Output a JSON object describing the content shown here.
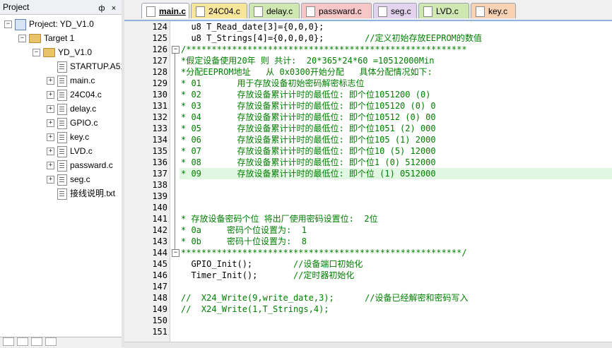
{
  "project_panel": {
    "title": "Project",
    "pin_label": "ф",
    "close_label": "×",
    "root": "Project: YD_V1.0",
    "target": "Target 1",
    "group": "YD_V1.0",
    "files": [
      "STARTUP.A51",
      "main.c",
      "24C04.c",
      "delay.c",
      "GPIO.c",
      "key.c",
      "LVD.c",
      "passward.c",
      "seg.c",
      "接线说明.txt"
    ]
  },
  "tabs": [
    {
      "label": "main.c",
      "color": "#ffffff",
      "active": true
    },
    {
      "label": "24C04.c",
      "color": "#f7e59a"
    },
    {
      "label": "delay.c",
      "color": "#cfe8b2"
    },
    {
      "label": "passward.c",
      "color": "#f7c6c6"
    },
    {
      "label": "seg.c",
      "color": "#e3d3ee"
    },
    {
      "label": "LVD.c",
      "color": "#cfe8b2"
    },
    {
      "label": "key.c",
      "color": "#f8d2b2"
    }
  ],
  "editor": {
    "highlight_color": "#e2f7e2",
    "lines": [
      {
        "num": "124",
        "code": "  u8 T_Read_date[3]={0,0,0};",
        "comment": ""
      },
      {
        "num": "125",
        "code": "  u8 T_Strings[4]={0,0,0,0};        ",
        "comment": "//定义初始存放EEPROM的数值"
      },
      {
        "num": "126",
        "code": "",
        "comment": "/*******************************************************"
      },
      {
        "num": "127",
        "code": "",
        "comment": "*假定设备使用20年 则 共计:  20*365*24*60 =10512000Min"
      },
      {
        "num": "128",
        "code": "",
        "comment": "*分配EEPROM地址   从 0x0300开始分配   具体分配情况如下:"
      },
      {
        "num": "129",
        "code": "",
        "comment": "* 01       用于存放设备初始密码解密标志位"
      },
      {
        "num": "130",
        "code": "",
        "comment": "* 02       存放设备累计计时的最低位: 即个位1051200 (0)"
      },
      {
        "num": "131",
        "code": "",
        "comment": "* 03       存放设备累计计时的最低位: 即个位105120 (0) 0"
      },
      {
        "num": "132",
        "code": "",
        "comment": "* 04       存放设备累计计时的最低位: 即个位10512 (0) 00"
      },
      {
        "num": "133",
        "code": "",
        "comment": "* 05       存放设备累计计时的最低位: 即个位1051 (2) 000"
      },
      {
        "num": "134",
        "code": "",
        "comment": "* 06       存放设备累计计时的最低位: 即个位105 (1) 2000"
      },
      {
        "num": "135",
        "code": "",
        "comment": "* 07       存放设备累计计时的最低位: 即个位10 (5) 12000"
      },
      {
        "num": "136",
        "code": "",
        "comment": "* 08       存放设备累计计时的最低位: 即个位1 (0) 512000"
      },
      {
        "num": "137",
        "code": "",
        "comment": "* 09       存放设备累计计时的最低位: 即个位 (1) 0512000"
      },
      {
        "num": "138",
        "code": "",
        "comment": ""
      },
      {
        "num": "139",
        "code": "",
        "comment": ""
      },
      {
        "num": "140",
        "code": "",
        "comment": ""
      },
      {
        "num": "141",
        "code": "",
        "comment": "* 存放设备密码个位 将出厂使用密码设置位:  2位"
      },
      {
        "num": "142",
        "code": "",
        "comment": "* 0a     密码个位设置为:  1"
      },
      {
        "num": "143",
        "code": "",
        "comment": "* 0b     密码十位设置为:  8"
      },
      {
        "num": "144",
        "code": "",
        "comment": "*******************************************************/"
      },
      {
        "num": "145",
        "code": "  GPIO_Init();        ",
        "comment": "//设备端口初始化"
      },
      {
        "num": "146",
        "code": "  Timer_Init();       ",
        "comment": "//定时器初始化"
      },
      {
        "num": "147",
        "code": "",
        "comment": ""
      },
      {
        "num": "148",
        "code": "",
        "comment": "//  X24_Write(9,write_date,3);      //设备已经解密和密码写入"
      },
      {
        "num": "149",
        "code": "",
        "comment": "//  X24_Write(1,T_Strings,4);"
      },
      {
        "num": "150",
        "code": "",
        "comment": ""
      },
      {
        "num": "151",
        "code": "",
        "comment": ""
      }
    ]
  }
}
